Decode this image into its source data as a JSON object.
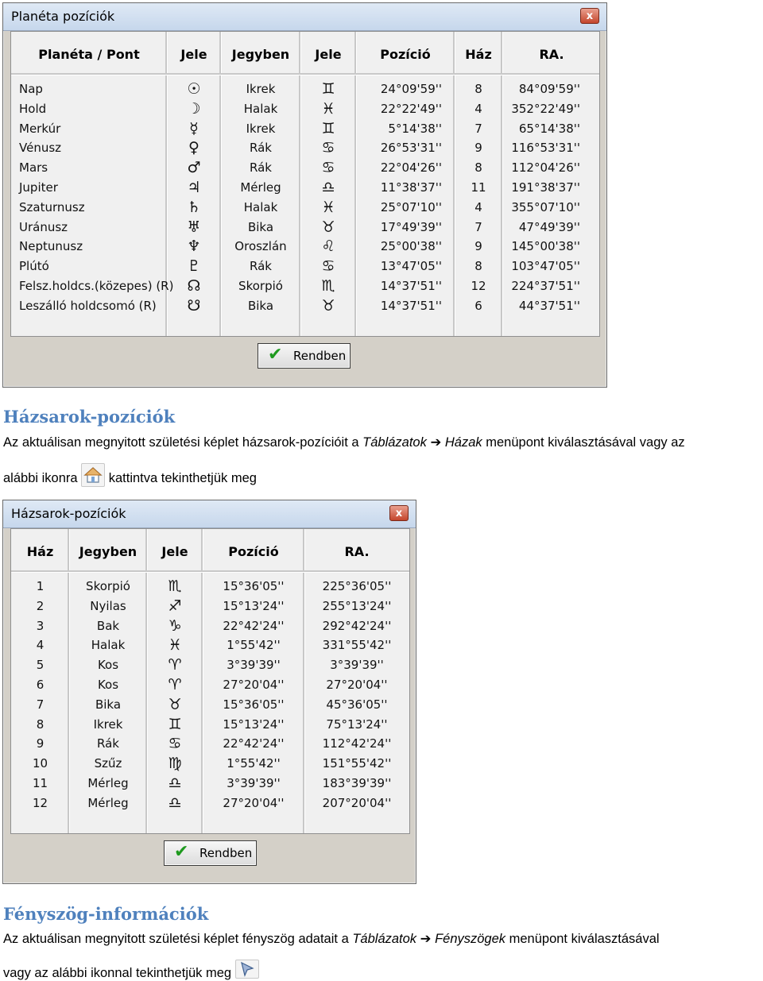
{
  "window1": {
    "title": "Planéta pozíciók",
    "close_label": "x",
    "headers": [
      "Planéta / Pont",
      "Jele",
      "Jegyben",
      "Jele",
      "Pozíció",
      "Ház",
      "RA."
    ],
    "rows": [
      {
        "name": "Nap",
        "psym": "☉",
        "sign": "Ikrek",
        "ssym": "♊",
        "pos": "24°09'59''",
        "house": "8",
        "ra": "84°09'59''"
      },
      {
        "name": "Hold",
        "psym": "☽",
        "sign": "Halak",
        "ssym": "♓",
        "pos": "22°22'49''",
        "house": "4",
        "ra": "352°22'49''"
      },
      {
        "name": "Merkúr",
        "psym": "☿",
        "sign": "Ikrek",
        "ssym": "♊",
        "pos": "5°14'38''",
        "house": "7",
        "ra": "65°14'38''"
      },
      {
        "name": "Vénusz",
        "psym": "♀",
        "sign": "Rák",
        "ssym": "♋",
        "pos": "26°53'31''",
        "house": "9",
        "ra": "116°53'31''"
      },
      {
        "name": "Mars",
        "psym": "♂",
        "sign": "Rák",
        "ssym": "♋",
        "pos": "22°04'26''",
        "house": "8",
        "ra": "112°04'26''"
      },
      {
        "name": "Jupiter",
        "psym": "♃",
        "sign": "Mérleg",
        "ssym": "♎",
        "pos": "11°38'37''",
        "house": "11",
        "ra": "191°38'37''"
      },
      {
        "name": "Szaturnusz",
        "psym": "♄",
        "sign": "Halak",
        "ssym": "♓",
        "pos": "25°07'10''",
        "house": "4",
        "ra": "355°07'10''"
      },
      {
        "name": "Uránusz",
        "psym": "♅",
        "sign": "Bika",
        "ssym": "♉",
        "pos": "17°49'39''",
        "house": "7",
        "ra": "47°49'39''"
      },
      {
        "name": "Neptunusz",
        "psym": "♆",
        "sign": "Oroszlán",
        "ssym": "♌",
        "pos": "25°00'38''",
        "house": "9",
        "ra": "145°00'38''"
      },
      {
        "name": "Plútó",
        "psym": "♇",
        "sign": "Rák",
        "ssym": "♋",
        "pos": "13°47'05''",
        "house": "8",
        "ra": "103°47'05''"
      },
      {
        "name": "Felsz.holdcs.(közepes) (R)",
        "psym": "☊",
        "sign": "Skorpió",
        "ssym": "♏",
        "pos": "14°37'51''",
        "house": "12",
        "ra": "224°37'51''"
      },
      {
        "name": "Leszálló holdcsomó (R)",
        "psym": "☋",
        "sign": "Bika",
        "ssym": "♉",
        "pos": "14°37'51''",
        "house": "6",
        "ra": "44°37'51''"
      }
    ],
    "ok_label": "Rendben"
  },
  "section1": {
    "heading": "Házsarok-pozíciók",
    "line1_a": "Az aktuálisan megnyitott születési képlet házsarok-pozícióit a ",
    "line1_menu1": "Táblázatok",
    "line1_arrow": "➔",
    "line1_menu2": "Házak",
    "line1_b": " menüpont kiválasztásával vagy az",
    "line2_a": "alábbi ikonra",
    "line2_b": "kattintva tekinthetjük meg"
  },
  "window2": {
    "title": "Házsarok-pozíciók",
    "close_label": "x",
    "headers": [
      "Ház",
      "Jegyben",
      "Jele",
      "Pozíció",
      "RA."
    ],
    "rows": [
      {
        "house": "1",
        "sign": "Skorpió",
        "ssym": "♏",
        "pos": "15°36'05''",
        "ra": "225°36'05''"
      },
      {
        "house": "2",
        "sign": "Nyilas",
        "ssym": "♐",
        "pos": "15°13'24''",
        "ra": "255°13'24''"
      },
      {
        "house": "3",
        "sign": "Bak",
        "ssym": "♑",
        "pos": "22°42'24''",
        "ra": "292°42'24''"
      },
      {
        "house": "4",
        "sign": "Halak",
        "ssym": "♓",
        "pos": "1°55'42''",
        "ra": "331°55'42''"
      },
      {
        "house": "5",
        "sign": "Kos",
        "ssym": "♈",
        "pos": "3°39'39''",
        "ra": "3°39'39''"
      },
      {
        "house": "6",
        "sign": "Kos",
        "ssym": "♈",
        "pos": "27°20'04''",
        "ra": "27°20'04''"
      },
      {
        "house": "7",
        "sign": "Bika",
        "ssym": "♉",
        "pos": "15°36'05''",
        "ra": "45°36'05''"
      },
      {
        "house": "8",
        "sign": "Ikrek",
        "ssym": "♊",
        "pos": "15°13'24''",
        "ra": "75°13'24''"
      },
      {
        "house": "9",
        "sign": "Rák",
        "ssym": "♋",
        "pos": "22°42'24''",
        "ra": "112°42'24''"
      },
      {
        "house": "10",
        "sign": "Szűz",
        "ssym": "♍",
        "pos": "1°55'42''",
        "ra": "151°55'42''"
      },
      {
        "house": "11",
        "sign": "Mérleg",
        "ssym": "♎",
        "pos": "3°39'39''",
        "ra": "183°39'39''"
      },
      {
        "house": "12",
        "sign": "Mérleg",
        "ssym": "♎",
        "pos": "27°20'04''",
        "ra": "207°20'04''"
      }
    ],
    "ok_label": "Rendben"
  },
  "section2": {
    "heading": "Fényszög-információk",
    "line1_a": "Az aktuálisan megnyitott születési képlet fényszög adatait a ",
    "line1_menu1": "Táblázatok",
    "line1_arrow": "➔",
    "line1_menu2": "Fényszögek",
    "line1_b": " menüpont kiválasztásával",
    "line2_a": "vagy az alábbi ikonnal tekinthetjük meg"
  },
  "icons": {
    "house_icon": "house-icon",
    "aspect_icon": "aspect-cursor-icon",
    "check_icon": "checkmark-icon"
  },
  "colors": {
    "heading": "#4f81bd",
    "check": "#1f9a1f"
  }
}
